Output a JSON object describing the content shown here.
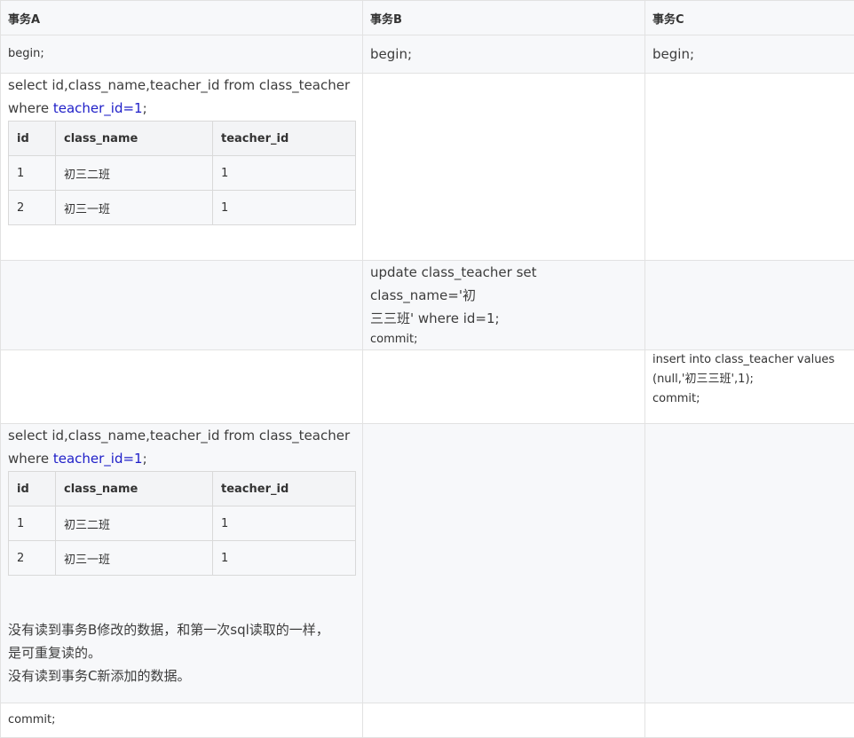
{
  "headers": [
    "事务A",
    "事务B",
    "事务C"
  ],
  "begin_a": "begin;",
  "begin_b": "begin;",
  "begin_c": "begin;",
  "select_sql": {
    "line1": "select id,class_name,teacher_id from class_teacher",
    "line2_prefix": "where ",
    "line2_highlight": "teacher_id=1",
    "line2_suffix": ";"
  },
  "result_table": {
    "columns": [
      "id",
      "class_name",
      "teacher_id"
    ],
    "rows": [
      [
        "1",
        "初三二班",
        "1"
      ],
      [
        "2",
        "初三一班",
        "1"
      ]
    ]
  },
  "update": {
    "line1": "update class_teacher set class_name='初",
    "line2": "三三班' where id=1;",
    "commit": "commit;"
  },
  "insert": {
    "line1": "insert into class_teacher values",
    "line2": "(null,'初三三班',1);",
    "commit": "commit;"
  },
  "note": {
    "line1": "没有读到事务B修改的数据，和第一次sql读取的一样，",
    "line2": "是可重复读的。",
    "line3": "没有读到事务C新添加的数据。"
  },
  "commit_a": "commit;"
}
